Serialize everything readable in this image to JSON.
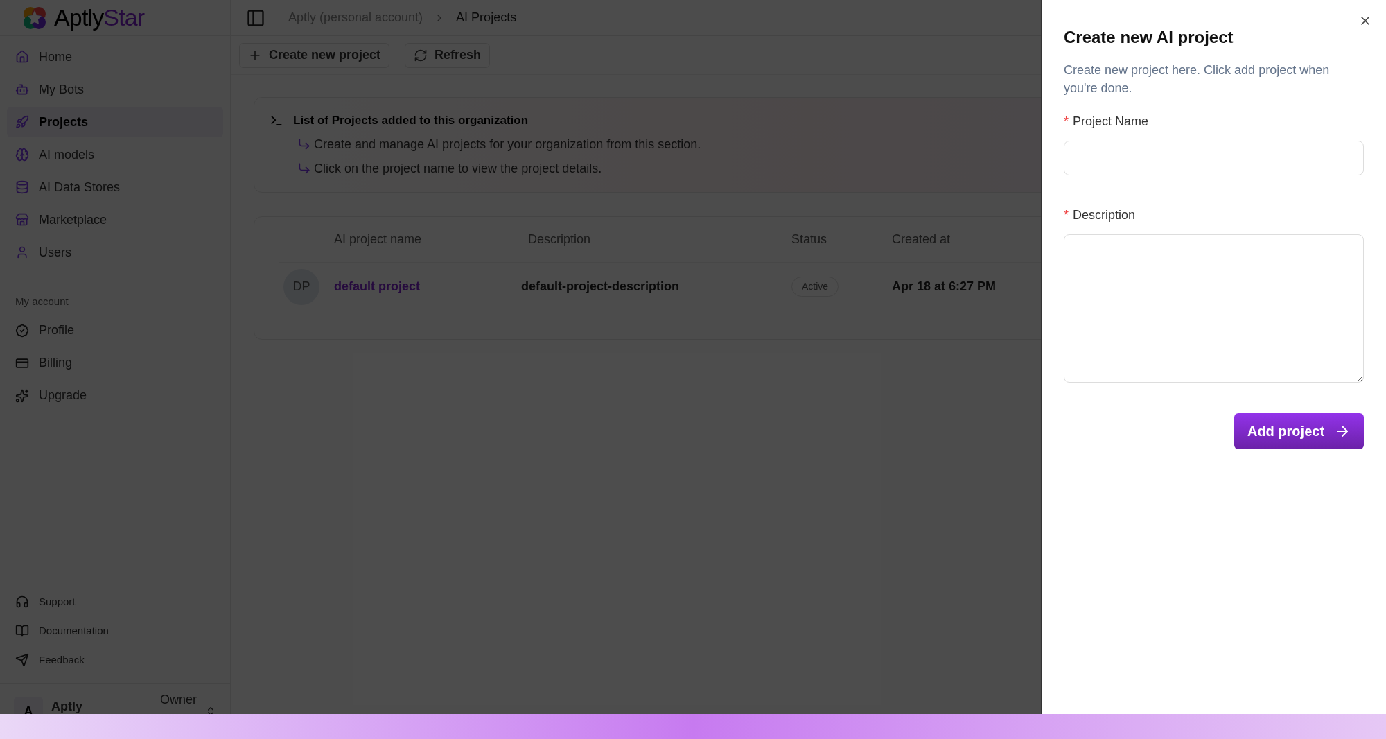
{
  "sidebar": {
    "logo": {
      "part_1": "Aptly",
      "part_2": "Star"
    },
    "nav_items": [
      {
        "label": "Home",
        "selected": false
      },
      {
        "label": "My Bots",
        "selected": false
      },
      {
        "label": "Projects",
        "selected": true
      },
      {
        "label": "AI models",
        "selected": false
      },
      {
        "label": "AI Data Stores",
        "selected": false
      },
      {
        "label": "Marketplace",
        "selected": false
      },
      {
        "label": "Users",
        "selected": false
      }
    ],
    "account_heading": "My account",
    "account_items": [
      {
        "label": "Profile"
      },
      {
        "label": "Billing"
      },
      {
        "label": "Upgrade"
      }
    ],
    "footer_items": [
      {
        "label": "Support"
      },
      {
        "label": "Documentation"
      },
      {
        "label": "Feedback"
      }
    ],
    "user": {
      "initial": "A",
      "name": "Aptly",
      "role": "Owner"
    }
  },
  "breadcrumb": [
    "Aptly (personal account)",
    "AI Projects"
  ],
  "toolbar": [
    {
      "label": "Create new project"
    },
    {
      "label": "Refresh"
    }
  ],
  "info_card": {
    "title": "List of Projects added to this organization",
    "lines": [
      "Create and manage AI projects for your organization from this section.",
      "Click on the project name to view the project details."
    ]
  },
  "table": {
    "columns": [
      "AI project name",
      "Description",
      "Status",
      "Created at"
    ],
    "rows": [
      {
        "initials": "DP",
        "name": "default project",
        "description": "default-project-description",
        "status": "Active",
        "created_at": "Apr 18 at 6:27 PM"
      }
    ]
  },
  "dialog": {
    "title": "Create new AI project",
    "description": "Create new project here. Click add project when you're done.",
    "fields": [
      {
        "label": "Project Name",
        "required_mark": "*",
        "kind": "input"
      },
      {
        "label": "Description",
        "required_mark": "*",
        "kind": "textarea"
      }
    ],
    "submit": "Add project"
  }
}
